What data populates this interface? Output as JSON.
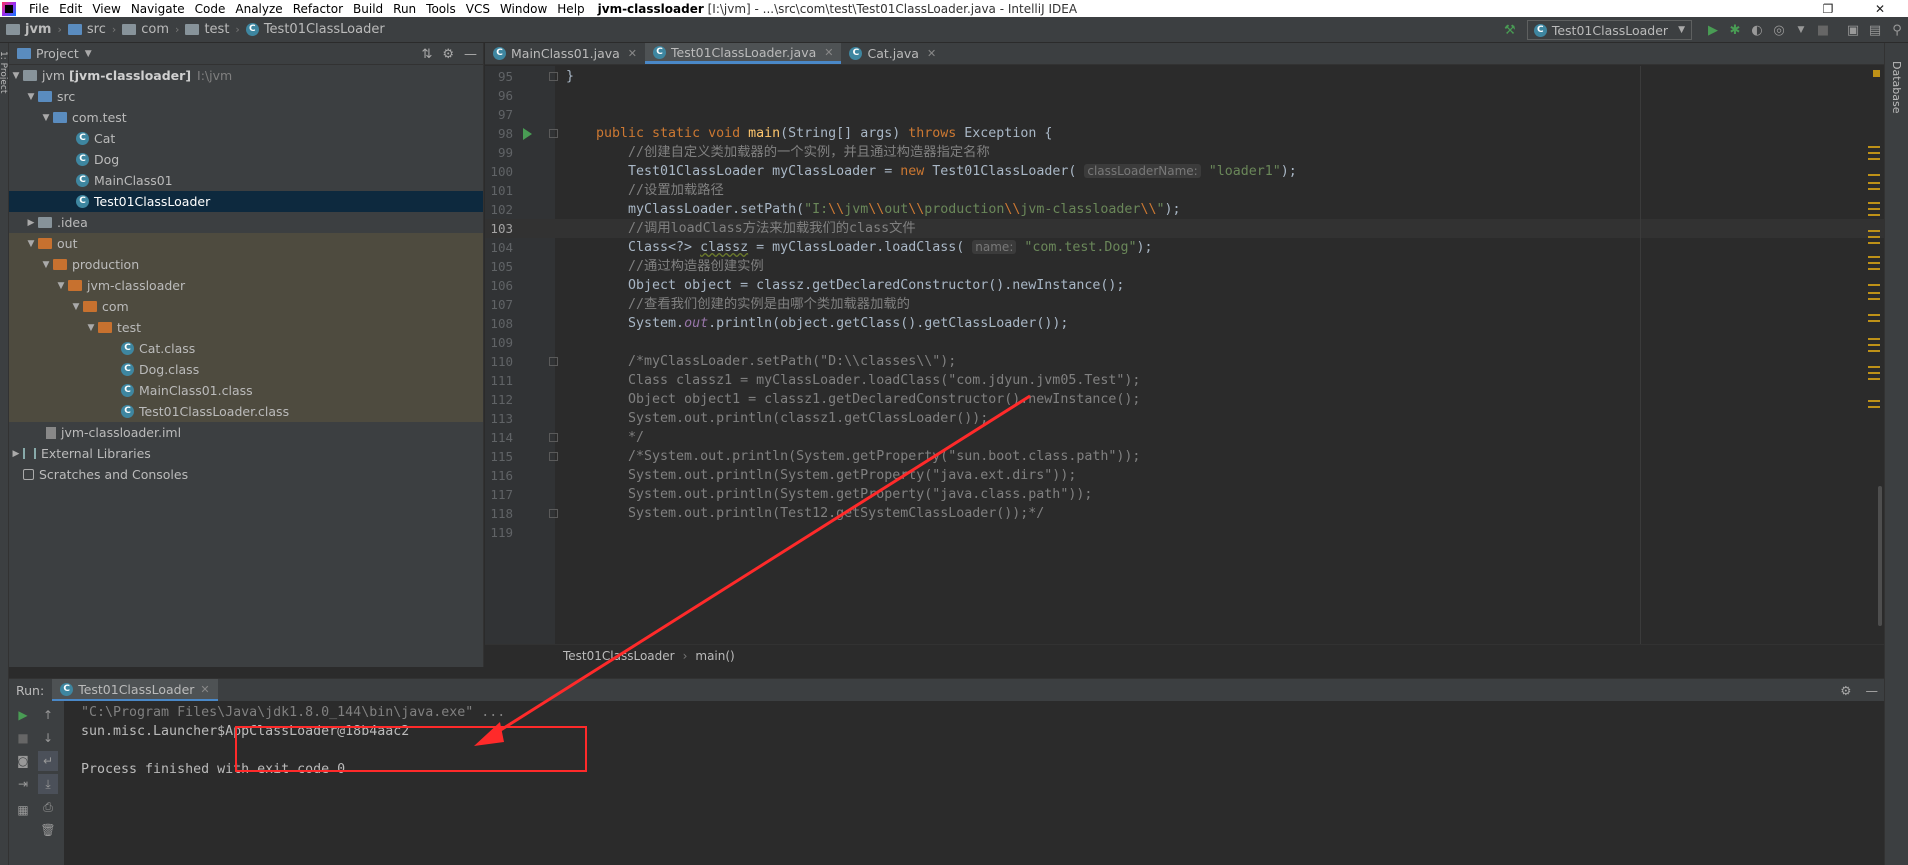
{
  "menubar": {
    "items": [
      "File",
      "Edit",
      "View",
      "Navigate",
      "Code",
      "Analyze",
      "Refactor",
      "Build",
      "Run",
      "Tools",
      "VCS",
      "Window",
      "Help"
    ],
    "title_project": "jvm-classloader",
    "title_rest": " [I:\\jvm] - ...\\src\\com\\test\\Test01ClassLoader.java - IntelliJ IDEA",
    "restore_glyph": "❐",
    "close_glyph": "✕"
  },
  "navbar": {
    "crumbs": [
      "jvm",
      "src",
      "com",
      "test",
      "Test01ClassLoader"
    ],
    "run_config": "Test01ClassLoader"
  },
  "project_panel": {
    "title": "Project",
    "tree": [
      {
        "label": "jvm",
        "extra": "[jvm-classloader]",
        "dim": "I:\\jvm",
        "level": 0,
        "arrow": "▼",
        "icon": "folder"
      },
      {
        "label": "src",
        "level": 1,
        "arrow": "▼",
        "icon": "folder-blue"
      },
      {
        "label": "com.test",
        "level": 2,
        "arrow": "▼",
        "icon": "package"
      },
      {
        "label": "Cat",
        "level": 3,
        "icon": "class"
      },
      {
        "label": "Dog",
        "level": 3,
        "icon": "class"
      },
      {
        "label": "MainClass01",
        "level": 3,
        "icon": "class"
      },
      {
        "label": "Test01ClassLoader",
        "level": 3,
        "icon": "class",
        "selected": true
      },
      {
        "label": ".idea",
        "level": 1,
        "arrow": "▶",
        "icon": "folder"
      },
      {
        "label": "out",
        "level": 1,
        "arrow": "▼",
        "icon": "folder-orange",
        "excluded": true
      },
      {
        "label": "production",
        "level": 2,
        "arrow": "▼",
        "icon": "folder-orange",
        "excluded": true
      },
      {
        "label": "jvm-classloader",
        "level": 3,
        "arrow": "▼",
        "icon": "folder-orange",
        "excluded": true
      },
      {
        "label": "com",
        "level": 4,
        "arrow": "▼",
        "icon": "folder-orange",
        "excluded": true
      },
      {
        "label": "test",
        "level": 5,
        "arrow": "▼",
        "icon": "folder-orange",
        "excluded": true
      },
      {
        "label": "Cat.class",
        "level": 6,
        "icon": "class",
        "excluded": true
      },
      {
        "label": "Dog.class",
        "level": 6,
        "icon": "class",
        "excluded": true
      },
      {
        "label": "MainClass01.class",
        "level": 6,
        "icon": "class",
        "excluded": true
      },
      {
        "label": "Test01ClassLoader.class",
        "level": 6,
        "icon": "class",
        "excluded": true
      },
      {
        "label": "jvm-classloader.iml",
        "level": 1,
        "icon": "iml"
      },
      {
        "label": "External Libraries",
        "level": 0,
        "arrow": "▶",
        "icon": "lib"
      },
      {
        "label": "Scratches and Consoles",
        "level": 0,
        "icon": "scratch"
      }
    ]
  },
  "editor": {
    "tabs": [
      {
        "label": "MainClass01.java",
        "active": false
      },
      {
        "label": "Test01ClassLoader.java",
        "active": true
      },
      {
        "label": "Cat.java",
        "active": false
      }
    ],
    "current_line": 103,
    "lines": [
      {
        "n": 95,
        "segs": [
          [
            "",
            "}"
          ]
        ]
      },
      {
        "n": 96,
        "segs": []
      },
      {
        "n": 97,
        "segs": []
      },
      {
        "n": 98,
        "run": true,
        "segs": [
          [
            "kw",
            "public static void "
          ],
          [
            "fn",
            "main"
          ],
          [
            "",
            "(String[] args) "
          ],
          [
            "kw",
            "throws "
          ],
          [
            "",
            "Exception {"
          ]
        ]
      },
      {
        "n": 99,
        "segs": [
          [
            "cmt",
            "    //创建自定义类加载器的一个实例，并且通过构造器指定名称"
          ]
        ]
      },
      {
        "n": 100,
        "segs": [
          [
            "",
            "    Test01ClassLoader myClassLoader = "
          ],
          [
            "kw",
            "new "
          ],
          [
            "",
            "Test01ClassLoader( "
          ],
          [
            "hint",
            "classLoaderName:"
          ],
          [
            "",
            " "
          ],
          [
            "str",
            "\"loader1\""
          ],
          [
            "",
            ");"
          ]
        ]
      },
      {
        "n": 101,
        "segs": [
          [
            "cmt",
            "    //设置加载路径"
          ]
        ]
      },
      {
        "n": 102,
        "segs": [
          [
            "",
            "    myClassLoader.setPath("
          ],
          [
            "str",
            "\"I:"
          ],
          [
            "esc",
            "\\\\"
          ],
          [
            "str",
            "jvm"
          ],
          [
            "esc",
            "\\\\"
          ],
          [
            "str",
            "out"
          ],
          [
            "esc",
            "\\\\"
          ],
          [
            "str",
            "production"
          ],
          [
            "esc",
            "\\\\"
          ],
          [
            "str",
            "jvm-classloader"
          ],
          [
            "esc",
            "\\\\"
          ],
          [
            "str",
            "\""
          ],
          [
            "",
            ");"
          ]
        ]
      },
      {
        "n": 103,
        "segs": [
          [
            "cmt",
            "    //调用loadClass方法来加载我们的class文件"
          ]
        ]
      },
      {
        "n": 104,
        "segs": [
          [
            "",
            "    Class<?> "
          ],
          [
            "ul",
            "classz"
          ],
          [
            "",
            " = myClassLoader.loadClass( "
          ],
          [
            "hint",
            "name:"
          ],
          [
            "",
            " "
          ],
          [
            "str",
            "\"com.test.Dog\""
          ],
          [
            "",
            ");"
          ]
        ]
      },
      {
        "n": 105,
        "segs": [
          [
            "cmt",
            "    //通过构造器创建实例"
          ]
        ]
      },
      {
        "n": 106,
        "segs": [
          [
            "",
            "    Object object = classz.getDeclaredConstructor().newInstance();"
          ]
        ]
      },
      {
        "n": 107,
        "segs": [
          [
            "cmt",
            "    //查看我们创建的实例是由哪个类加载器加载的"
          ]
        ]
      },
      {
        "n": 108,
        "segs": [
          [
            "",
            "    System."
          ],
          [
            "st",
            "out"
          ],
          [
            "",
            ".println(object.getClass().getClassLoader());"
          ]
        ]
      },
      {
        "n": 109,
        "segs": []
      },
      {
        "n": 110,
        "segs": [
          [
            "cmt",
            "    /*myClassLoader.setPath(\"D:\\\\classes\\\\\");"
          ]
        ]
      },
      {
        "n": 111,
        "segs": [
          [
            "cmt",
            "    Class classz1 = myClassLoader.loadClass(\"com.jdyun.jvm05.Test\");"
          ]
        ]
      },
      {
        "n": 112,
        "segs": [
          [
            "cmt",
            "    Object object1 = classz1.getDeclaredConstructor().newInstance();"
          ]
        ]
      },
      {
        "n": 113,
        "segs": [
          [
            "cmt",
            "    System.out.println(classz1.getClassLoader());"
          ]
        ]
      },
      {
        "n": 114,
        "segs": [
          [
            "cmt",
            "    */"
          ]
        ]
      },
      {
        "n": 115,
        "segs": [
          [
            "cmt",
            "    /*System.out.println(System.getProperty(\"sun.boot.class.path\"));"
          ]
        ]
      },
      {
        "n": 116,
        "segs": [
          [
            "cmt",
            "    System.out.println(System.getProperty(\"java.ext.dirs\"));"
          ]
        ]
      },
      {
        "n": 117,
        "segs": [
          [
            "cmt",
            "    System.out.println(System.getProperty(\"java.class.path\"));"
          ]
        ]
      },
      {
        "n": 118,
        "segs": [
          [
            "cmt",
            "    System.out.println(Test12.getSystemClassLoader());*/"
          ]
        ]
      },
      {
        "n": 119,
        "segs": []
      }
    ],
    "breadcrumb": [
      "Test01ClassLoader",
      "main()"
    ]
  },
  "right_stripe": {
    "label": "Database"
  },
  "left_stripe": {
    "label": "1: Project"
  },
  "run_panel": {
    "label": "Run:",
    "tab": "Test01ClassLoader",
    "console": [
      {
        "kind": "cmd",
        "text": "\"C:\\Program Files\\Java\\jdk1.8.0_144\\bin\\java.exe\" ..."
      },
      {
        "kind": "out",
        "text": "sun.misc.Launcher$AppClassLoader@18b4aac2"
      },
      {
        "kind": "out",
        "text": ""
      },
      {
        "kind": "out",
        "text": "Process finished with exit code 0"
      }
    ]
  },
  "colors": {
    "annotation": "#ff2a2a",
    "bg": "#2b2b2b",
    "panel": "#3c3f41"
  }
}
